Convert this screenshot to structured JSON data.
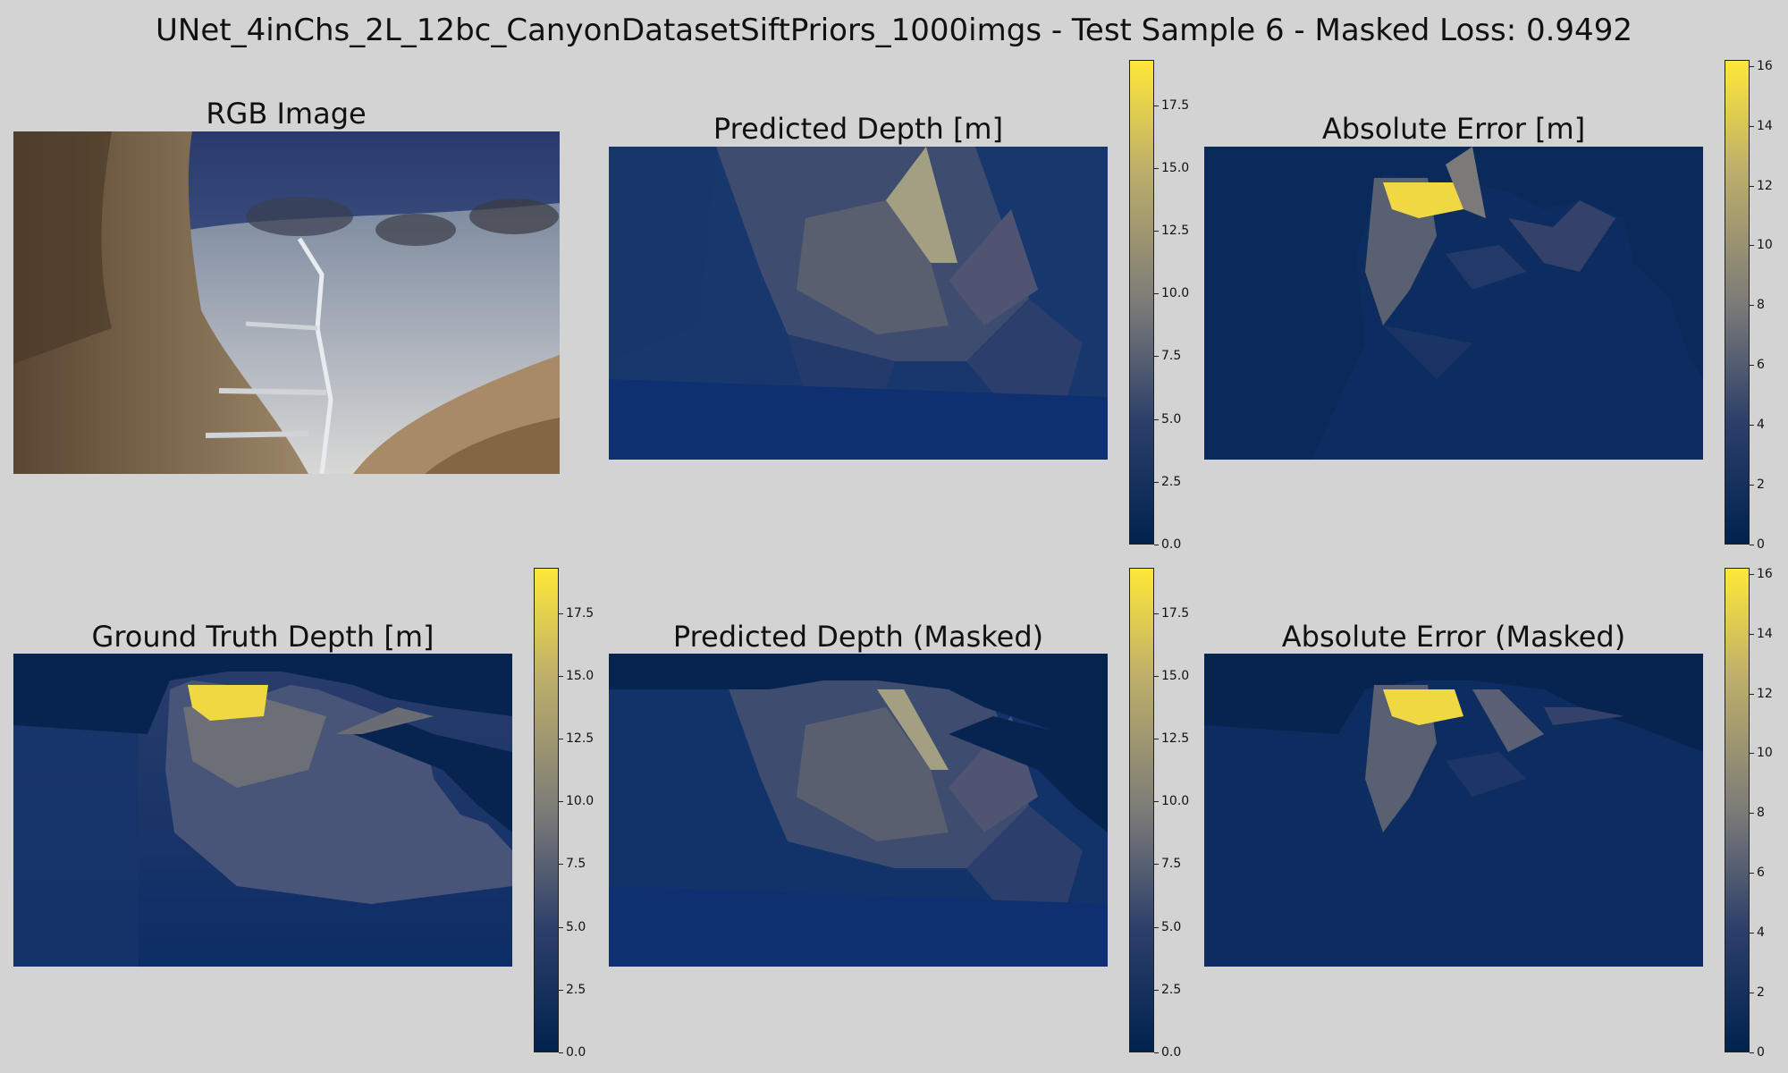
{
  "suptitle": "UNet_4inChs_2L_12bc_CanyonDatasetSiftPriors_1000imgs - Test Sample 6 - Masked Loss: 0.9492",
  "colormap": "cividis",
  "colors": {
    "background": "#d3d3d3",
    "cmap_low": "#00224e",
    "cmap_mid": "#7c7b78",
    "cmap_high": "#fee838"
  },
  "panels": {
    "rgb": {
      "title": "RGB Image"
    },
    "pred": {
      "title": "Predicted Depth [m]"
    },
    "abs_err": {
      "title": "Absolute Error [m]"
    },
    "gt": {
      "title": "Ground Truth Depth [m]"
    },
    "pred_masked": {
      "title": "Predicted Depth (Masked)"
    },
    "abs_err_masked": {
      "title": "Absolute Error (Masked)"
    }
  },
  "chart_data": [
    {
      "type": "heatmap",
      "title": "RGB Image"
    },
    {
      "type": "heatmap",
      "title": "Predicted Depth [m]",
      "colorbar_range": [
        0,
        19.3
      ],
      "colorbar_ticks": [
        "0.0",
        "2.5",
        "5.0",
        "7.5",
        "10.0",
        "12.5",
        "15.0",
        "17.5"
      ]
    },
    {
      "type": "heatmap",
      "title": "Absolute Error [m]",
      "colorbar_range": [
        0,
        16.2
      ],
      "colorbar_ticks": [
        "0",
        "2",
        "4",
        "6",
        "8",
        "10",
        "12",
        "14",
        "16"
      ]
    },
    {
      "type": "heatmap",
      "title": "Ground Truth Depth [m]",
      "colorbar_range": [
        0,
        19.3
      ],
      "colorbar_ticks": [
        "0.0",
        "2.5",
        "5.0",
        "7.5",
        "10.0",
        "12.5",
        "15.0",
        "17.5"
      ]
    },
    {
      "type": "heatmap",
      "title": "Predicted Depth (Masked)",
      "colorbar_range": [
        0,
        19.3
      ],
      "colorbar_ticks": [
        "0.0",
        "2.5",
        "5.0",
        "7.5",
        "10.0",
        "12.5",
        "15.0",
        "17.5"
      ]
    },
    {
      "type": "heatmap",
      "title": "Absolute Error (Masked)",
      "colorbar_range": [
        0,
        16.2
      ],
      "colorbar_ticks": [
        "0",
        "2",
        "4",
        "6",
        "8",
        "10",
        "12",
        "14",
        "16"
      ]
    }
  ]
}
